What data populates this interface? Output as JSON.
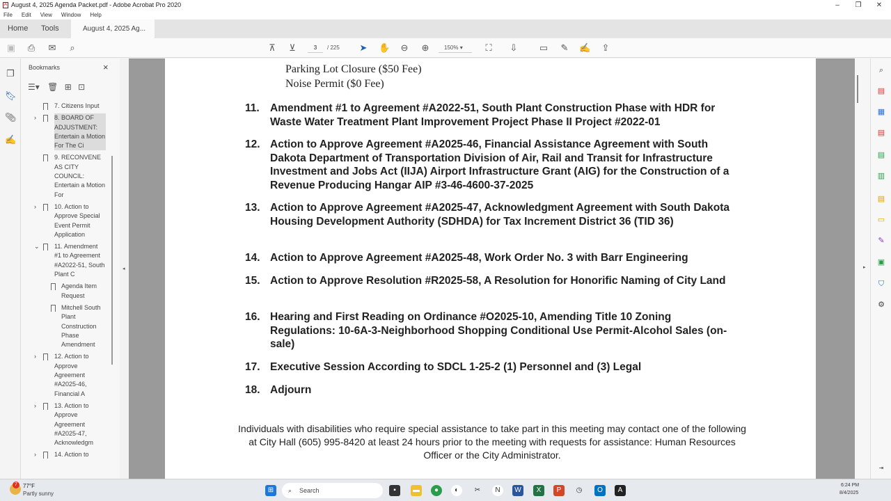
{
  "window": {
    "title": "August 4, 2025 Agenda Packet.pdf - Adobe Acrobat Pro 2020"
  },
  "menu": [
    "File",
    "Edit",
    "View",
    "Window",
    "Help"
  ],
  "tabs": {
    "home": "Home",
    "tools": "Tools",
    "doc": "August 4, 2025 Ag...",
    "close": "×"
  },
  "toolbar": {
    "page": "3",
    "total": "/ 225",
    "zoom": "150%"
  },
  "bookmarks": {
    "title": "Bookmarks",
    "close": "×",
    "items": [
      {
        "label": "7. Citizens Input",
        "chev": "",
        "sub": false,
        "sel": false
      },
      {
        "label": "8. BOARD OF ADJUSTMENT: Entertain a Motion For The Ci",
        "chev": "›",
        "sub": false,
        "sel": true
      },
      {
        "label": "9. RECONVENE AS CITY COUNCIL: Entertain a Motion For",
        "chev": "",
        "sub": false,
        "sel": false
      },
      {
        "label": "10. Action to Approve Special Event Permit Application",
        "chev": "›",
        "sub": false,
        "sel": false
      },
      {
        "label": "11. Amendment #1 to Agreement #A2022-51, South Plant C",
        "chev": "⌄",
        "sub": false,
        "sel": false
      },
      {
        "label": "Agenda Item Request",
        "chev": "",
        "sub": true,
        "sel": false
      },
      {
        "label": "Mitchell South Plant Construction Phase Amendment",
        "chev": "",
        "sub": true,
        "sel": false
      },
      {
        "label": "12. Action to Approve Agreement #A2025-46, Financial A",
        "chev": "›",
        "sub": false,
        "sel": false
      },
      {
        "label": "13. Action to Approve Agreement #A2025-47, Acknowledgm",
        "chev": "›",
        "sub": false,
        "sel": false
      },
      {
        "label": "14. Action to",
        "chev": "›",
        "sub": false,
        "sel": false
      }
    ]
  },
  "document": {
    "lines": [
      "Parking Lot Closure ($50 Fee)",
      "Noise Permit ($0 Fee)"
    ],
    "items": [
      {
        "n": "11.",
        "t": "Amendment #1 to Agreement #A2022-51, South Plant Construction Phase with HDR for Waste Water Treatment Plant Improvement Project Phase II Project #2022-01"
      },
      {
        "n": "12.",
        "t": "Action to Approve Agreement #A2025-46, Financial Assistance Agreement with South Dakota Department of Transportation Division of Air, Rail and Transit for Infrastructure Investment and Jobs Act (IIJA) Airport Infrastructure Grant (AIG) for the Construction of a Revenue Producing Hangar AIP #3-46-4600-37-2025"
      },
      {
        "n": "13.",
        "t": "Action to Approve Agreement #A2025-47, Acknowledgment Agreement with South Dakota Housing Development Authority (SDHDA) for Tax Increment District 36 (TID 36)"
      },
      {
        "n": "14.",
        "t": "Action to Approve Agreement #A2025-48, Work Order No. 3 with Barr Engineering"
      },
      {
        "n": "15.",
        "t": "Action to Approve Resolution #R2025-58, A Resolution for Honorific Naming of City Land"
      },
      {
        "n": "16.",
        "t": "Hearing and First Reading on Ordinance #O2025-10, Amending Title 10 Zoning Regulations: 10-6A-3-Neighborhood Shopping Conditional Use Permit-Alcohol Sales (on-sale)"
      },
      {
        "n": "17.",
        "t": "Executive Session According to SDCL 1-25-2 (1) Personnel and (3) Legal"
      },
      {
        "n": "18.",
        "t": "Adjourn"
      }
    ],
    "note": "Individuals with disabilities who require special assistance to take part in this meeting may contact one of the following at City Hall (605) 995-8420 at least 24 hours prior to the meeting with requests for assistance: Human Resources Officer or the City Administrator."
  },
  "taskbar": {
    "temp": "77°F",
    "weather": "Partly sunny",
    "badge": "7",
    "search": "Search",
    "time": "6:24 PM",
    "date": "8/4/2025"
  }
}
